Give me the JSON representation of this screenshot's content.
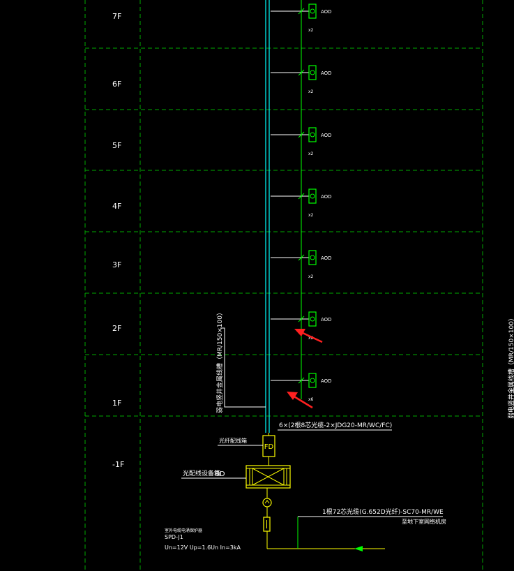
{
  "floors": [
    "7F",
    "6F",
    "5F",
    "4F",
    "3F",
    "2F",
    "1F",
    "-1F"
  ],
  "outlets": [
    {
      "label": "AOD",
      "count": "x2"
    },
    {
      "label": "AOD",
      "count": "x2"
    },
    {
      "label": "AOD",
      "count": "x2"
    },
    {
      "label": "AOD",
      "count": "x2"
    },
    {
      "label": "AOD",
      "count": "x2"
    },
    {
      "label": "AOD",
      "count": "x2"
    },
    {
      "label": "AOD",
      "count": "x6"
    }
  ],
  "annotations": {
    "riser_cable": "6×(2根8芯光缆-2×JDG20-MR/WC/FC)",
    "vertical_tray_left": "弱电竖井金属线槽（MR/150×100）",
    "vertical_tray_right": "弱电竖井金属线槽（MR/150×100）",
    "fd_label": "FD",
    "fd_desc": "光纤配线箱",
    "bd_label": "BD",
    "bd_desc": "光配线设备箱",
    "incoming_cable": "1根72芯光缆(G.652D光纤)-SC70-MR/WE",
    "incoming_dest": "至地下室网络机房",
    "spd_title": "室外电缆电涌保护器",
    "spd_model": "SPD-J1",
    "spd_params": "Un=12V Up=1.6Un In=3kA"
  },
  "colors": {
    "grid": "#00aa00",
    "riser": "#00ffff",
    "wire": "#00ff00",
    "equipment": "#ffff00",
    "leader": "#ffffff",
    "arrow": "#ff2020"
  }
}
